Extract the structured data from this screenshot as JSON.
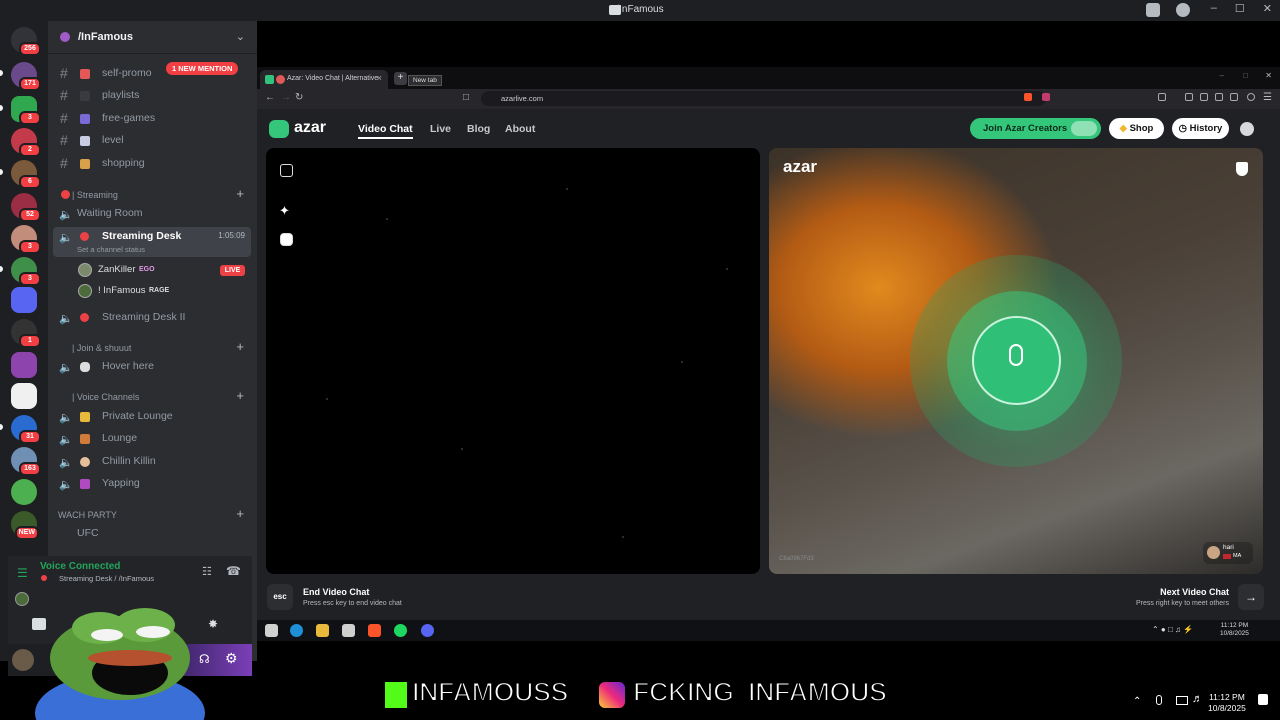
{
  "window": {
    "title": "/InFamous"
  },
  "server_rail": {
    "badges": [
      "256",
      "171",
      "3",
      "2",
      "6",
      "52",
      "3",
      "3",
      "1",
      "31",
      "163",
      "NEW"
    ]
  },
  "sidebar": {
    "server_name": "/InFamous",
    "mention_badge": "1 NEW MENTION",
    "text_channels": [
      {
        "label": "self-promo"
      },
      {
        "label": "playlists"
      },
      {
        "label": "free-games"
      },
      {
        "label": "level"
      },
      {
        "label": "shopping"
      }
    ],
    "streaming_category": "| Streaming",
    "waiting_room": "Waiting Room",
    "streaming_desk": {
      "label": "Streaming Desk",
      "timer": "1:05:09",
      "status": "Set a channel status"
    },
    "members": [
      {
        "name": "ZanKiller",
        "tag": "EGO",
        "live": "LIVE"
      },
      {
        "name": "! InFamous",
        "tag": "RAGE"
      }
    ],
    "streaming_desk_2": "Streaming Desk II",
    "join_category": "| Join & shuuut",
    "hover_here": "Hover here",
    "voice_category": "| Voice Channels",
    "voice_channels": [
      "Private Lounge",
      "Lounge",
      "Chillin Killin",
      "Yapping"
    ],
    "watch_category": "WACH PARTY",
    "ufc": "UFC"
  },
  "voice_panel": {
    "status": "Voice Connected",
    "location": "Streaming Desk / /InFamous"
  },
  "browser": {
    "tab_title": "Azar: Video Chat | Alternative",
    "new_tab_tooltip": "New tab",
    "url": "azarlive.com"
  },
  "azar": {
    "logo": "azar",
    "nav": [
      "Video Chat",
      "Live",
      "Blog",
      "About"
    ],
    "creators_button": "Join Azar Creators",
    "shop_button": "Shop",
    "history_button": "History",
    "overlay_logo": "azar",
    "video_id": "C8a0967Fd3",
    "remote_user": "hari",
    "remote_country": "MA",
    "esc_key": "esc",
    "end_title": "End Video Chat",
    "end_sub": "Press esc key to end video chat",
    "next_title": "Next Video Chat",
    "next_sub": "Press right key to meet others",
    "clock_time": "11:12 PM",
    "clock_date": "10/8/2025"
  },
  "banner": {
    "handle1": "INFAMOUSS",
    "handle2": "FCKING_INFAMOUS"
  },
  "outer_clock": {
    "time": "11:12 PM",
    "date": "10/8/2025"
  },
  "colors": {
    "azar_green": "#34c77b",
    "discord_red": "#f23f43",
    "live_red": "#ed4245"
  }
}
